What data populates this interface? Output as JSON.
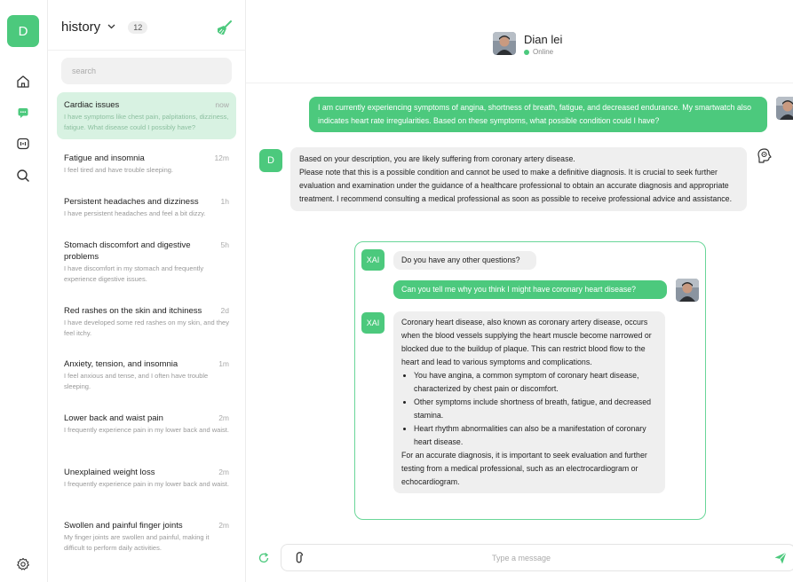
{
  "rail": {
    "avatar_letter": "D",
    "icons": [
      "home-icon",
      "chat-icon",
      "bot-icon",
      "search-icon",
      "settings-icon"
    ],
    "accent": "#4cc97d"
  },
  "history": {
    "title": "history",
    "count": "12",
    "search_placeholder": "search",
    "items": [
      {
        "title": "Cardiac issues",
        "time": "now",
        "desc": "I have symptoms like chest pain, palpitations, dizziness, fatigue. What disease could I possibly have?"
      },
      {
        "title": "Fatigue and insomnia",
        "time": "12m",
        "desc": "I feel tired and have trouble sleeping."
      },
      {
        "title": "Persistent headaches and dizziness",
        "time": "1h",
        "desc": "I have persistent headaches and feel a bit dizzy."
      },
      {
        "title": "Stomach discomfort and digestive problems",
        "time": "5h",
        "desc": "I have discomfort in my stomach and frequently experience digestive issues."
      },
      {
        "title": "Red rashes on the skin and itchiness",
        "time": "2d",
        "desc": "I have developed some red rashes on my skin, and they feel itchy."
      },
      {
        "title": "Anxiety, tension, and insomnia",
        "time": "1m",
        "desc": "I feel anxious and tense, and I often have trouble sleeping."
      },
      {
        "title": "Lower back and waist pain",
        "time": "2m",
        "desc": "I frequently experience pain in my lower back and waist."
      },
      {
        "title": "Unexplained weight loss",
        "time": "2m",
        "desc": "I frequently experience pain in my lower back and waist."
      },
      {
        "title": "Swollen and painful finger joints",
        "time": "2m",
        "desc": "My finger joints are swollen and painful, making it difficult to perform daily activities."
      }
    ]
  },
  "chat": {
    "contact_name": "Dian lei",
    "status": "Online",
    "user_message": "I am currently experiencing symptoms of angina, shortness of breath, fatigue, and decreased endurance. My smartwatch also indicates heart rate irregularities. Based on these symptoms, what possible condition could I have?",
    "bot_badge": "D",
    "bot_reply_line1": "Based on your description, you are likely suffering from coronary artery disease.",
    "bot_reply_line2": "Please note that this is a possible condition and cannot be used to make a definitive diagnosis. It is crucial to seek further evaluation and examination under the guidance of a healthcare professional to obtain an accurate diagnosis and appropriate treatment. I recommend consulting a medical professional as soon as possible to receive professional advice and assistance.",
    "xai": {
      "badge": "XAI",
      "question": "Do you have any other questions?",
      "user_question": "Can you tell me why you think I might have coronary heart disease?",
      "answer_intro": "Coronary heart disease, also known as coronary artery disease, occurs when the blood vessels supplying the heart muscle become narrowed or blocked due to the buildup of plaque. This can restrict blood flow to the heart and lead to various symptoms and complications.",
      "answer_bullets": [
        "You have angina, a common symptom of coronary heart disease, characterized by chest pain or discomfort.",
        "Other symptoms include shortness of breath, fatigue, and decreased stamina.",
        "Heart rhythm abnormalities can also be a manifestation of coronary heart disease."
      ],
      "answer_outro": "For an accurate diagnosis, it is important to seek evaluation and further testing from a medical professional, such as an electrocardiogram or echocardiogram."
    },
    "input_placeholder": "Type a message"
  }
}
